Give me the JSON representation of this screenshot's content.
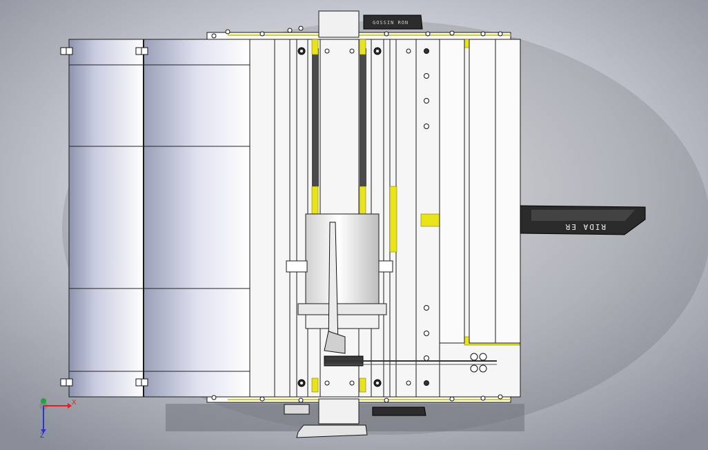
{
  "view": {
    "type": "cad-3d-model-top-view",
    "background_gradient": [
      "#f3f4f7",
      "#c4c7cf",
      "#8a8e98"
    ],
    "colors": {
      "frame": "#f4f4f4",
      "outline": "#1a1a1a",
      "accent_yellow": "#e9e31a",
      "roller_shade": "#8f94ad",
      "roller_light": "#ffffff",
      "dark_part": "#2a2a2a"
    }
  },
  "nameplates": {
    "top_text": "GOSSIN RON",
    "side_text": "RIDA ER"
  },
  "triad": {
    "x_label": "X",
    "z_label": "Z",
    "x_color": "#e0201b",
    "z_color": "#2a35d8",
    "y_color": "#1aa83a"
  }
}
